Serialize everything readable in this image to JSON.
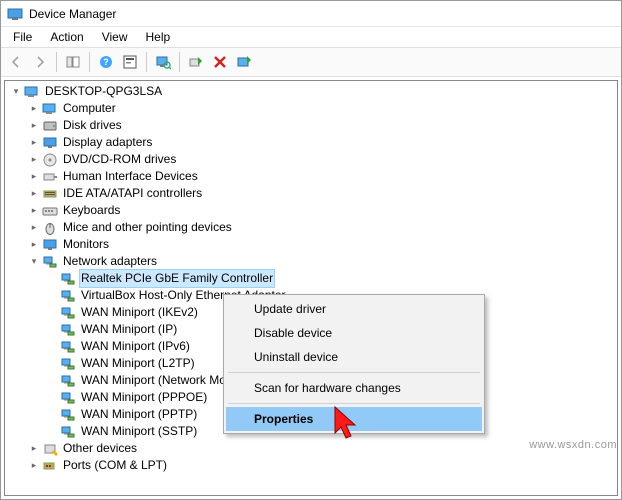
{
  "window": {
    "title": "Device Manager"
  },
  "menubar": {
    "items": [
      "File",
      "Action",
      "View",
      "Help"
    ]
  },
  "toolbar": {
    "icons": [
      "back",
      "forward",
      "sep",
      "show-hide",
      "sep",
      "help-bubble",
      "properties-box",
      "sep",
      "monitor-update",
      "sep",
      "enable-green",
      "disable-red",
      "update-driver"
    ]
  },
  "tree": {
    "root": {
      "label": "DESKTOP-QPG3LSA",
      "expanded": true,
      "icon": "computer-icon"
    },
    "categories": [
      {
        "label": "Computer",
        "icon": "computer-icon",
        "expanded": false
      },
      {
        "label": "Disk drives",
        "icon": "disk-icon",
        "expanded": false
      },
      {
        "label": "Display adapters",
        "icon": "display-icon",
        "expanded": false
      },
      {
        "label": "DVD/CD-ROM drives",
        "icon": "optical-icon",
        "expanded": false
      },
      {
        "label": "Human Interface Devices",
        "icon": "hid-icon",
        "expanded": false
      },
      {
        "label": "IDE ATA/ATAPI controllers",
        "icon": "ide-icon",
        "expanded": false
      },
      {
        "label": "Keyboards",
        "icon": "keyboard-icon",
        "expanded": false
      },
      {
        "label": "Mice and other pointing devices",
        "icon": "mouse-icon",
        "expanded": false
      },
      {
        "label": "Monitors",
        "icon": "monitor-icon",
        "expanded": false
      },
      {
        "label": "Network adapters",
        "icon": "network-icon",
        "expanded": true,
        "children": [
          {
            "label": "Realtek PCIe GbE Family Controller",
            "icon": "network-icon",
            "selected": true
          },
          {
            "label": "VirtualBox Host-Only Ethernet Adapter",
            "icon": "network-icon"
          },
          {
            "label": "WAN Miniport (IKEv2)",
            "icon": "network-icon"
          },
          {
            "label": "WAN Miniport (IP)",
            "icon": "network-icon"
          },
          {
            "label": "WAN Miniport (IPv6)",
            "icon": "network-icon"
          },
          {
            "label": "WAN Miniport (L2TP)",
            "icon": "network-icon"
          },
          {
            "label": "WAN Miniport (Network Monitor)",
            "icon": "network-icon"
          },
          {
            "label": "WAN Miniport (PPPOE)",
            "icon": "network-icon"
          },
          {
            "label": "WAN Miniport (PPTP)",
            "icon": "network-icon"
          },
          {
            "label": "WAN Miniport (SSTP)",
            "icon": "network-icon"
          }
        ]
      },
      {
        "label": "Other devices",
        "icon": "other-icon",
        "expanded": false
      },
      {
        "label": "Ports (COM & LPT)",
        "icon": "port-icon",
        "expanded": false
      }
    ]
  },
  "context_menu": {
    "items": [
      {
        "label": "Update driver",
        "type": "item"
      },
      {
        "label": "Disable device",
        "type": "item"
      },
      {
        "label": "Uninstall device",
        "type": "item"
      },
      {
        "type": "sep"
      },
      {
        "label": "Scan for hardware changes",
        "type": "item"
      },
      {
        "type": "sep"
      },
      {
        "label": "Properties",
        "type": "item",
        "highlight": true,
        "bold": true
      }
    ]
  },
  "watermark": "www.wsxdn.com"
}
